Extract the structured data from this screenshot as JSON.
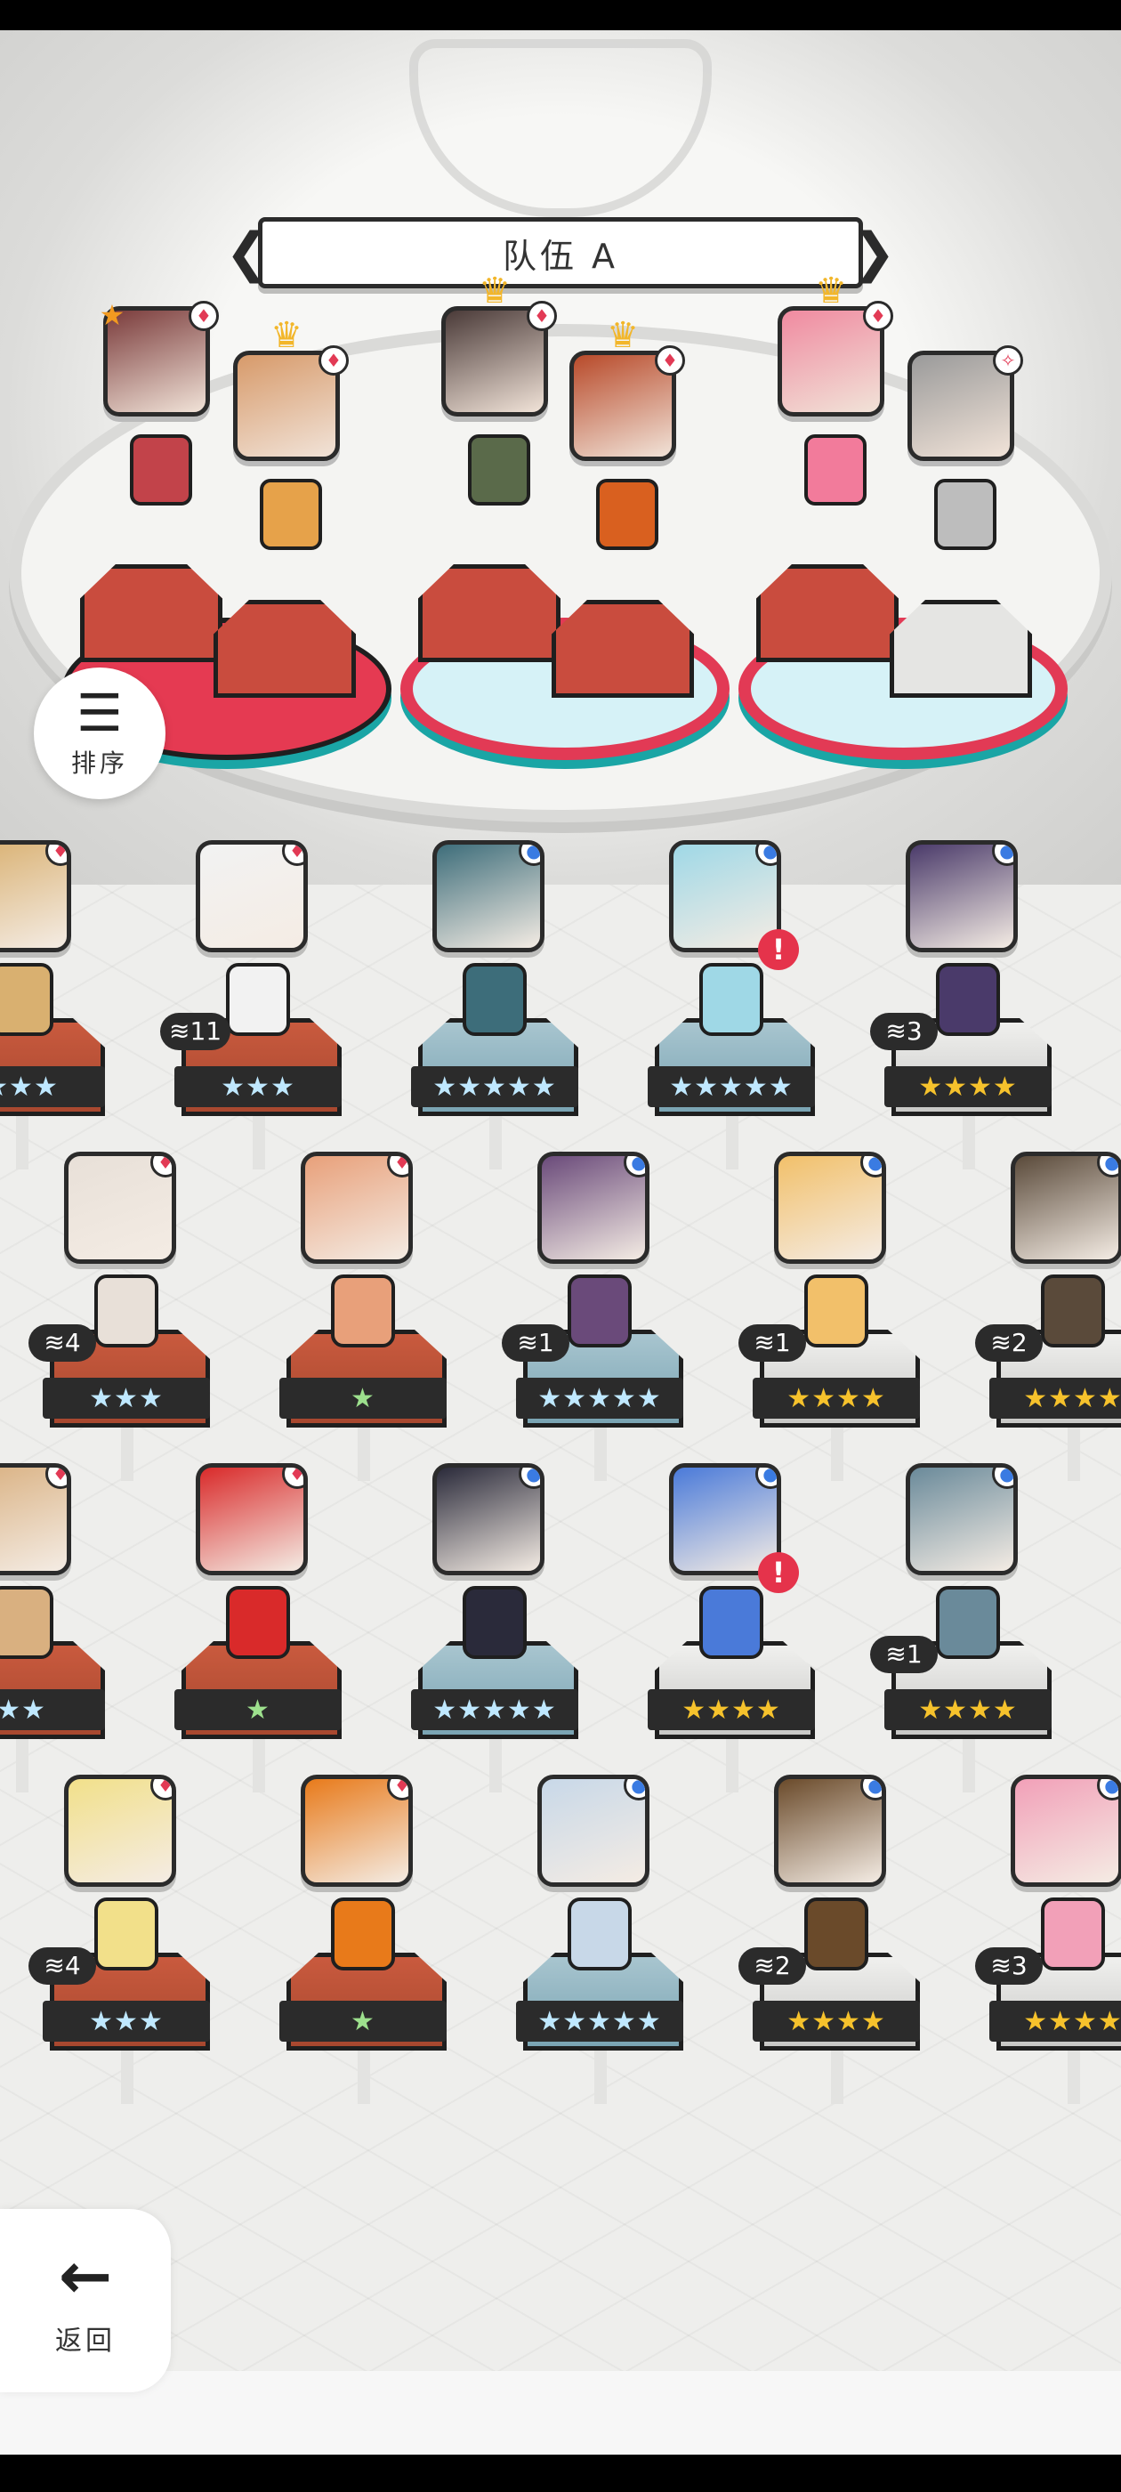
{
  "team": {
    "name": "队伍 A",
    "prev_arrow": "❮",
    "next_arrow": "❯",
    "members": [
      {
        "element": "fire",
        "leader": true,
        "crowned": false,
        "color": "#7a3b3b",
        "sprite_color": "#c2434a"
      },
      {
        "element": "fire",
        "leader": false,
        "crowned": true,
        "color": "#d79a6a",
        "sprite_color": "#e6a24a"
      },
      {
        "element": "fire",
        "leader": false,
        "crowned": true,
        "color": "#4a3a38",
        "sprite_color": "#5a6a4a"
      },
      {
        "element": "fire",
        "leader": false,
        "crowned": true,
        "color": "#b84a2a",
        "sprite_color": "#d9601f"
      },
      {
        "element": "fire",
        "leader": false,
        "crowned": true,
        "color": "#f08aa0",
        "sprite_color": "#f27b9b"
      },
      {
        "element": "light",
        "leader": false,
        "crowned": false,
        "color": "#9a9a9a",
        "sprite_color": "#bdbdbd"
      }
    ]
  },
  "sort": {
    "label": "排序",
    "icon": "sort-icon"
  },
  "back": {
    "label": "返回",
    "icon": "back-arrow-icon"
  },
  "roster": [
    {
      "element": "fire",
      "stars": "★★★",
      "star_color": "blue",
      "count": "",
      "pedestal": "red",
      "color": "#d9b070",
      "alert": false
    },
    {
      "element": "fire",
      "stars": "★★★",
      "star_color": "blue",
      "count": "11",
      "pedestal": "red",
      "color": "#f2f2f2",
      "alert": false
    },
    {
      "element": "water",
      "stars": "★★★★★",
      "star_color": "blue",
      "count": "",
      "pedestal": "blue",
      "color": "#3d6d7a",
      "alert": false
    },
    {
      "element": "water",
      "stars": "★★★★★",
      "star_color": "blue",
      "count": "",
      "pedestal": "blue",
      "color": "#9fd8e6",
      "alert": true
    },
    {
      "element": "water",
      "stars": "★★★★",
      "star_color": "gold",
      "count": "3",
      "pedestal": "white",
      "color": "#4a3a6a",
      "alert": false
    },
    {
      "element": "fire",
      "stars": "★★★",
      "star_color": "blue",
      "count": "4",
      "pedestal": "red",
      "color": "#e8e0d8",
      "alert": false
    },
    {
      "element": "fire",
      "stars": "★",
      "star_color": "green",
      "count": "",
      "pedestal": "red",
      "color": "#e8a07a",
      "alert": false
    },
    {
      "element": "water",
      "stars": "★★★★★",
      "star_color": "blue",
      "count": "1",
      "pedestal": "blue",
      "color": "#6a4a7a",
      "alert": false
    },
    {
      "element": "water",
      "stars": "★★★★",
      "star_color": "gold",
      "count": "1",
      "pedestal": "white",
      "color": "#f2c06a",
      "alert": false
    },
    {
      "element": "water",
      "stars": "★★★★",
      "star_color": "gold",
      "count": "2",
      "pedestal": "white",
      "color": "#5a4a3a",
      "alert": false
    },
    {
      "element": "fire",
      "stars": "★★",
      "star_color": "blue",
      "count": "",
      "pedestal": "red",
      "color": "#d9b080",
      "alert": false
    },
    {
      "element": "fire",
      "stars": "★",
      "star_color": "green",
      "count": "",
      "pedestal": "red",
      "color": "#d92a2a",
      "alert": false
    },
    {
      "element": "water",
      "stars": "★★★★★",
      "star_color": "blue",
      "count": "",
      "pedestal": "blue",
      "color": "#2a2a3a",
      "alert": false
    },
    {
      "element": "water",
      "stars": "★★★★",
      "star_color": "gold",
      "count": "",
      "pedestal": "white",
      "color": "#4a7ad9",
      "alert": true
    },
    {
      "element": "water",
      "stars": "★★★★",
      "star_color": "gold",
      "count": "1",
      "pedestal": "white",
      "color": "#6a8a9a",
      "alert": false
    },
    {
      "element": "fire",
      "stars": "★★★",
      "star_color": "blue",
      "count": "4",
      "pedestal": "red",
      "color": "#f2e08a",
      "alert": false
    },
    {
      "element": "fire",
      "stars": "★",
      "star_color": "green",
      "count": "",
      "pedestal": "red",
      "color": "#e87a1a",
      "alert": false
    },
    {
      "element": "water",
      "stars": "★★★★★",
      "star_color": "blue",
      "count": "",
      "pedestal": "blue",
      "color": "#c8d8e8",
      "alert": false
    },
    {
      "element": "water",
      "stars": "★★★★",
      "star_color": "gold",
      "count": "2",
      "pedestal": "white",
      "color": "#6a4a2a",
      "alert": false
    },
    {
      "element": "water",
      "stars": "★★★★",
      "star_color": "gold",
      "count": "3",
      "pedestal": "white",
      "color": "#f2a0b8",
      "alert": false
    }
  ]
}
